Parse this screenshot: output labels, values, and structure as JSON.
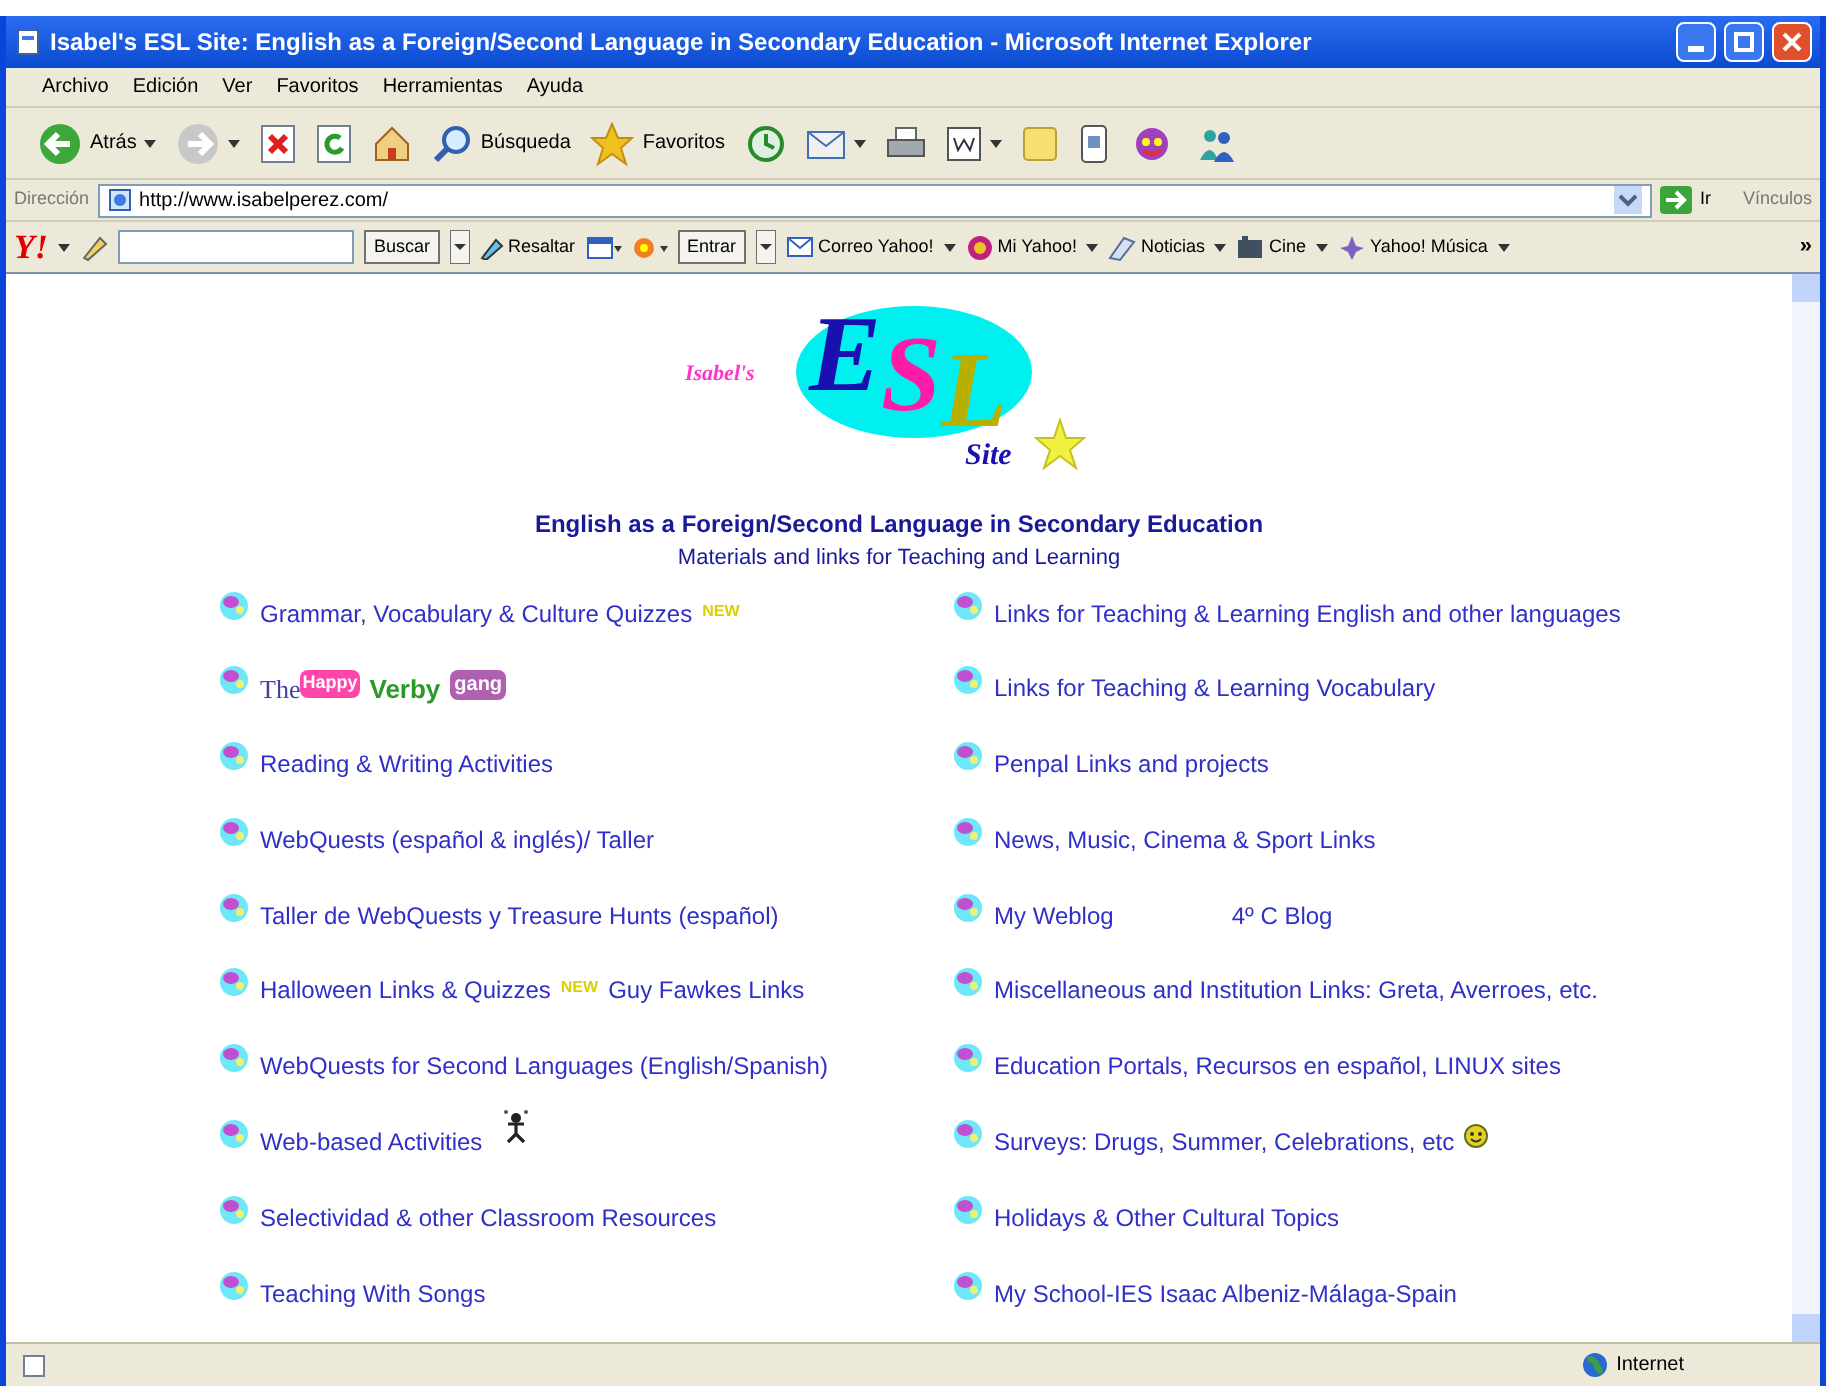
{
  "window": {
    "title": "Isabel's ESL Site: English as a Foreign/Second Language in Secondary Education - Microsoft Internet Explorer"
  },
  "menu": [
    "Archivo",
    "Edición",
    "Ver",
    "Favoritos",
    "Herramientas",
    "Ayuda"
  ],
  "toolbar": {
    "back": "Atrás",
    "search": "Búsqueda",
    "favorites": "Favoritos"
  },
  "address": {
    "label": "Dirección",
    "value": "http://www.isabelperez.com/",
    "go": "Ir",
    "links": "Vínculos"
  },
  "yahoo_toolbar": {
    "logo": "Y!",
    "buttons": [
      "Buscar",
      "Resaltar",
      "Entrar"
    ],
    "links": [
      "Correo Yahoo!",
      "Mi Yahoo!",
      "Noticias",
      "Cine",
      "Yahoo! Música"
    ],
    "more": "»"
  },
  "logo": {
    "prefix": "Isabel's",
    "letters": [
      "E",
      "S",
      "L"
    ],
    "suffix": "Site"
  },
  "heading": "English as a Foreign/Second Language in Secondary Education",
  "subheading": "Materials and links for Teaching and Learning",
  "left_links": [
    {
      "parts": [
        {
          "kind": "link",
          "text": "Grammar, Vocabulary & Culture Quizzes"
        },
        {
          "kind": "new",
          "text": "NEW"
        }
      ]
    },
    {
      "parts": [
        {
          "kind": "verby",
          "text": "The"
        },
        {
          "kind": "happy",
          "text": "Happy"
        },
        {
          "kind": "verbyword",
          "text": "Verby"
        },
        {
          "kind": "gang",
          "text": "gang"
        }
      ]
    },
    {
      "parts": [
        {
          "kind": "link",
          "text": "Reading & Writing Activities"
        }
      ]
    },
    {
      "parts": [
        {
          "kind": "link",
          "text": "WebQuests (español & inglés)/ Taller"
        }
      ]
    },
    {
      "parts": [
        {
          "kind": "link",
          "text": "Taller de WebQuests y Treasure Hunts (español)"
        }
      ]
    },
    {
      "parts": [
        {
          "kind": "link",
          "text": "Halloween Links & Quizzes"
        },
        {
          "kind": "new",
          "text": "NEW"
        },
        {
          "kind": "link",
          "text": "Guy Fawkes Links"
        }
      ]
    },
    {
      "parts": [
        {
          "kind": "link",
          "text": "WebQuests for Second Languages (English/Spanish)"
        }
      ]
    },
    {
      "parts": [
        {
          "kind": "link",
          "text": "Web-based Activities"
        },
        {
          "kind": "figure"
        }
      ]
    },
    {
      "parts": [
        {
          "kind": "link",
          "text": "Selectividad & other Classroom Resources"
        }
      ]
    },
    {
      "parts": [
        {
          "kind": "link",
          "text": "Teaching With Songs"
        }
      ]
    }
  ],
  "right_links": [
    {
      "parts": [
        {
          "kind": "link",
          "text": "Links for Teaching & Learning English and other languages"
        }
      ]
    },
    {
      "parts": [
        {
          "kind": "link",
          "text": "Links for Teaching & Learning Vocabulary"
        }
      ]
    },
    {
      "parts": [
        {
          "kind": "link",
          "text": "Penpal Links and projects"
        }
      ]
    },
    {
      "parts": [
        {
          "kind": "link",
          "text": "News, Music, Cinema & Sport Links"
        }
      ]
    },
    {
      "parts": [
        {
          "kind": "link",
          "text": "My Weblog"
        },
        {
          "kind": "farlink",
          "text": "4º C Blog"
        }
      ]
    },
    {
      "parts": [
        {
          "kind": "link",
          "text": "Miscellaneous and Institution Links: Greta, Averroes, etc."
        }
      ]
    },
    {
      "parts": [
        {
          "kind": "link",
          "text": "Education Portals, Recursos en español, LINUX sites"
        }
      ]
    },
    {
      "parts": [
        {
          "kind": "link",
          "text": "Surveys: Drugs, Summer, Celebrations, etc"
        },
        {
          "kind": "smiley"
        }
      ]
    },
    {
      "parts": [
        {
          "kind": "link",
          "text": "Holidays & Other Cultural Topics"
        }
      ]
    },
    {
      "parts": [
        {
          "kind": "link",
          "text": "My School-IES Isaac Albeniz-Málaga-Spain"
        }
      ]
    }
  ],
  "status_bar": {
    "zone": "Internet"
  }
}
